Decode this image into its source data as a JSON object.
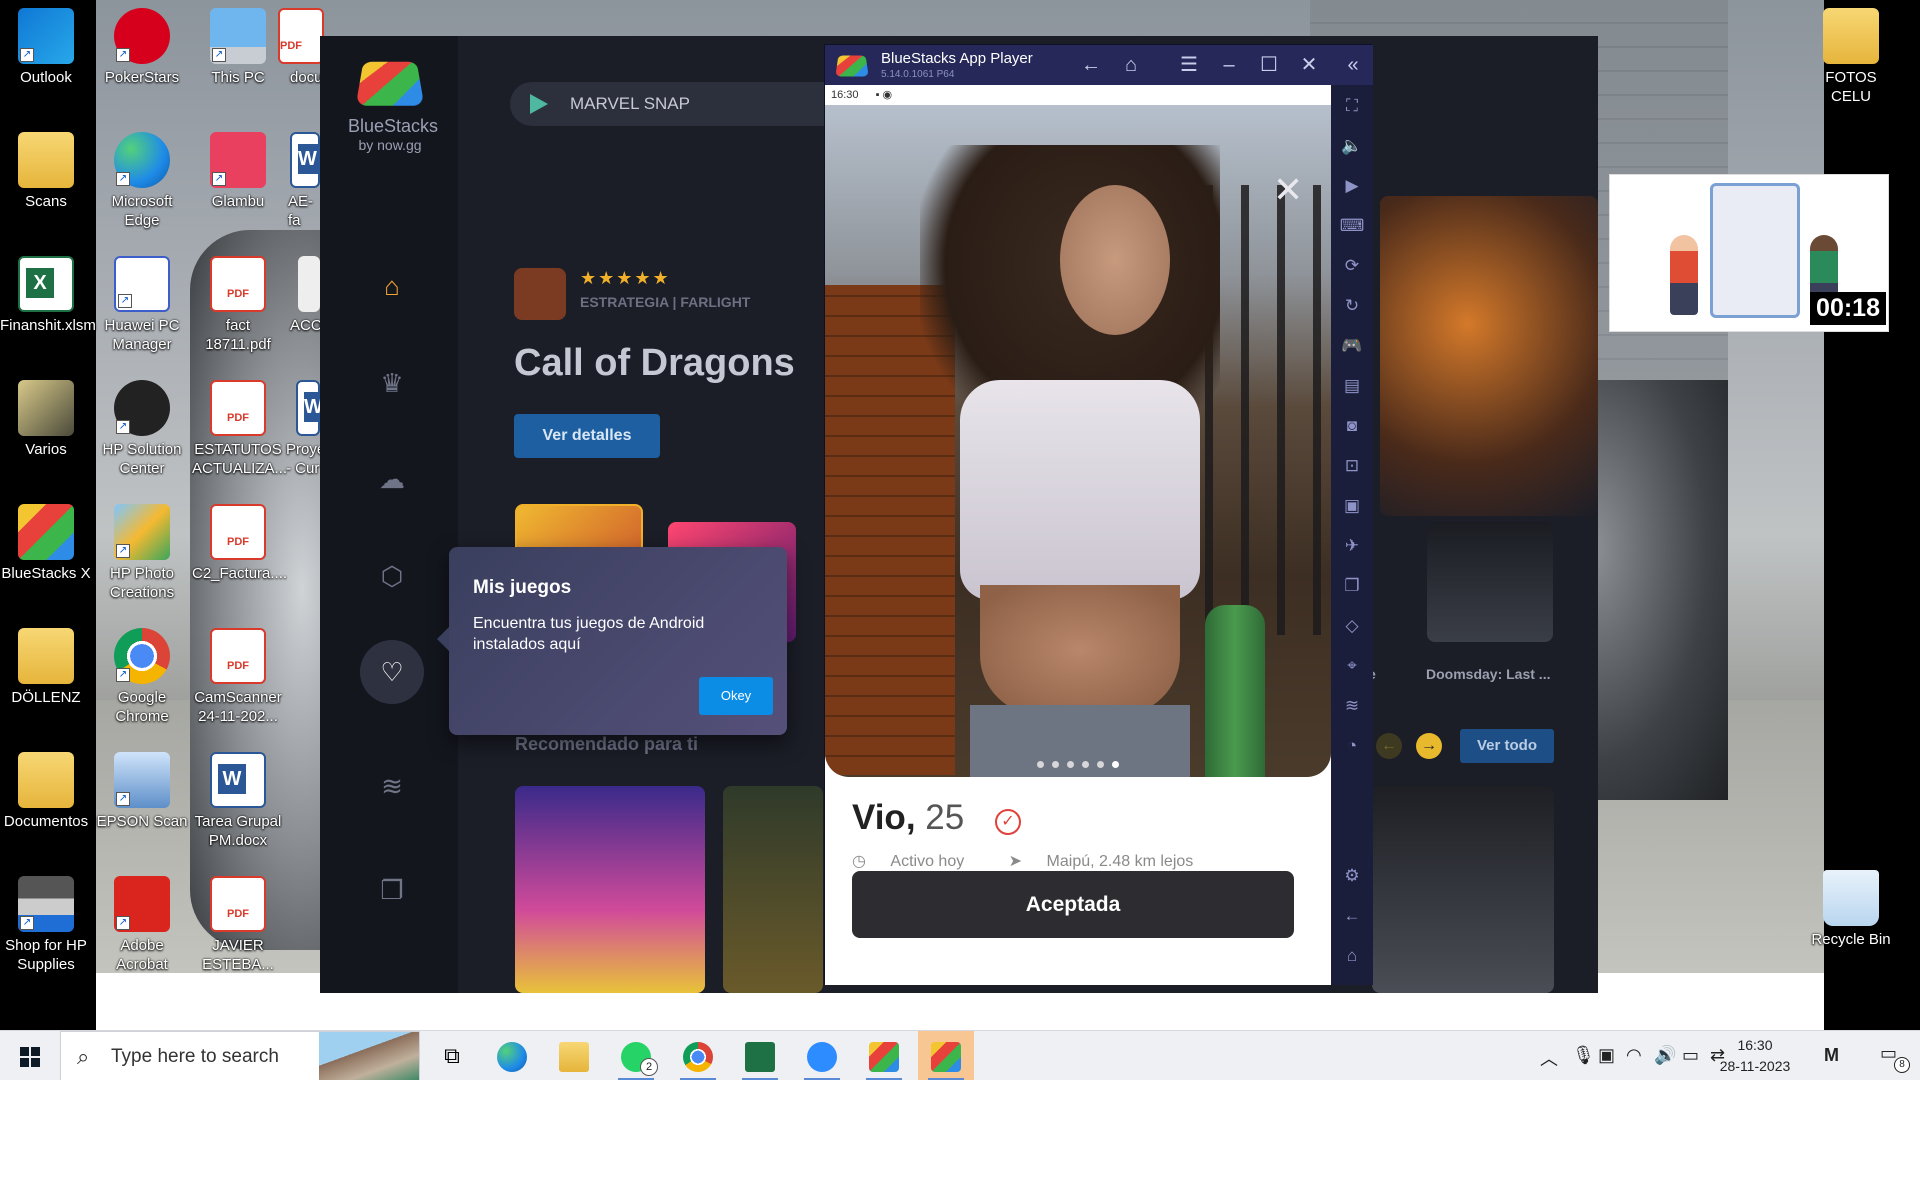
{
  "desktop": {
    "left_icons": [
      {
        "label": "Outlook"
      },
      {
        "label": "Scans"
      },
      {
        "label": "Finanshit.xlsm"
      },
      {
        "label": "Varios"
      },
      {
        "label": "BlueStacks X"
      },
      {
        "label": "DÖLLENZ"
      },
      {
        "label": "Documentos"
      },
      {
        "label": "Shop for HP Supplies"
      }
    ],
    "middle_icons": [
      {
        "label": "PokerStars"
      },
      {
        "label": "Microsoft Edge"
      },
      {
        "label": "Huawei PC Manager"
      },
      {
        "label": "HP Solution Center"
      },
      {
        "label": "HP Photo Creations"
      },
      {
        "label": "Google Chrome"
      },
      {
        "label": "EPSON Scan"
      },
      {
        "label": "Adobe Acrobat"
      }
    ],
    "third_icons": [
      {
        "label": "This PC"
      },
      {
        "label": "Glambu"
      },
      {
        "label": "fact 18711.pdf"
      },
      {
        "label": "ESTATUTOS ACTUALIZA..."
      },
      {
        "label": "C2_Factura...."
      },
      {
        "label": "CamScanner 24-11-202..."
      },
      {
        "label": "Tarea Grupal PM.docx"
      },
      {
        "label": "JAVIER ESTEBA..."
      }
    ],
    "partial_icons": [
      {
        "label": "docu"
      },
      {
        "label": "AE-fa"
      },
      {
        "label": "ACO"
      },
      {
        "label": "Proye - Cur"
      }
    ],
    "right_icons": [
      {
        "label": "FOTOS CELU"
      },
      {
        "label": "Recycle Bin"
      }
    ]
  },
  "bluestacks": {
    "logo_name": "BlueStacks",
    "logo_by": "by now.gg",
    "search_text": "MARVEL SNAP",
    "hero": {
      "rating": "★★★★★",
      "genres": "ESTRATEGIA  |  FARLIGHT",
      "title": "Call of Dragons",
      "details_button": "Ver detalles"
    },
    "recommended_title": "Recomendado para ti",
    "see_all": "Ver todo",
    "tile_label_right": "Doomsday: Last ...",
    "tile_label_partial": "e",
    "tooltip": {
      "title": "Mis juegos",
      "body": "Encuentra tus juegos de Android instalados aquí",
      "ok": "Okey"
    }
  },
  "player": {
    "title": "BlueStacks App Player",
    "version": "5.14.0.1061  P64",
    "status_time": "16:30",
    "profile": {
      "name": "Vio,",
      "age": "25",
      "active": "Activo hoy",
      "location": "Maipú, 2.48 km lejos",
      "button": "Aceptada",
      "photo_count": 6,
      "photo_index": 6
    }
  },
  "floating_video": {
    "time": "00:18"
  },
  "taskbar": {
    "search_placeholder": "Type here to search",
    "whatsapp_badge": "2",
    "clock_time": "16:30",
    "clock_date": "28-11-2023",
    "notification_count": "8"
  },
  "colors": {
    "accent_blue": "#0b8de6",
    "verified_red": "#e2413b",
    "bs_sidebar": "#14161e",
    "player_bar": "#252858"
  }
}
